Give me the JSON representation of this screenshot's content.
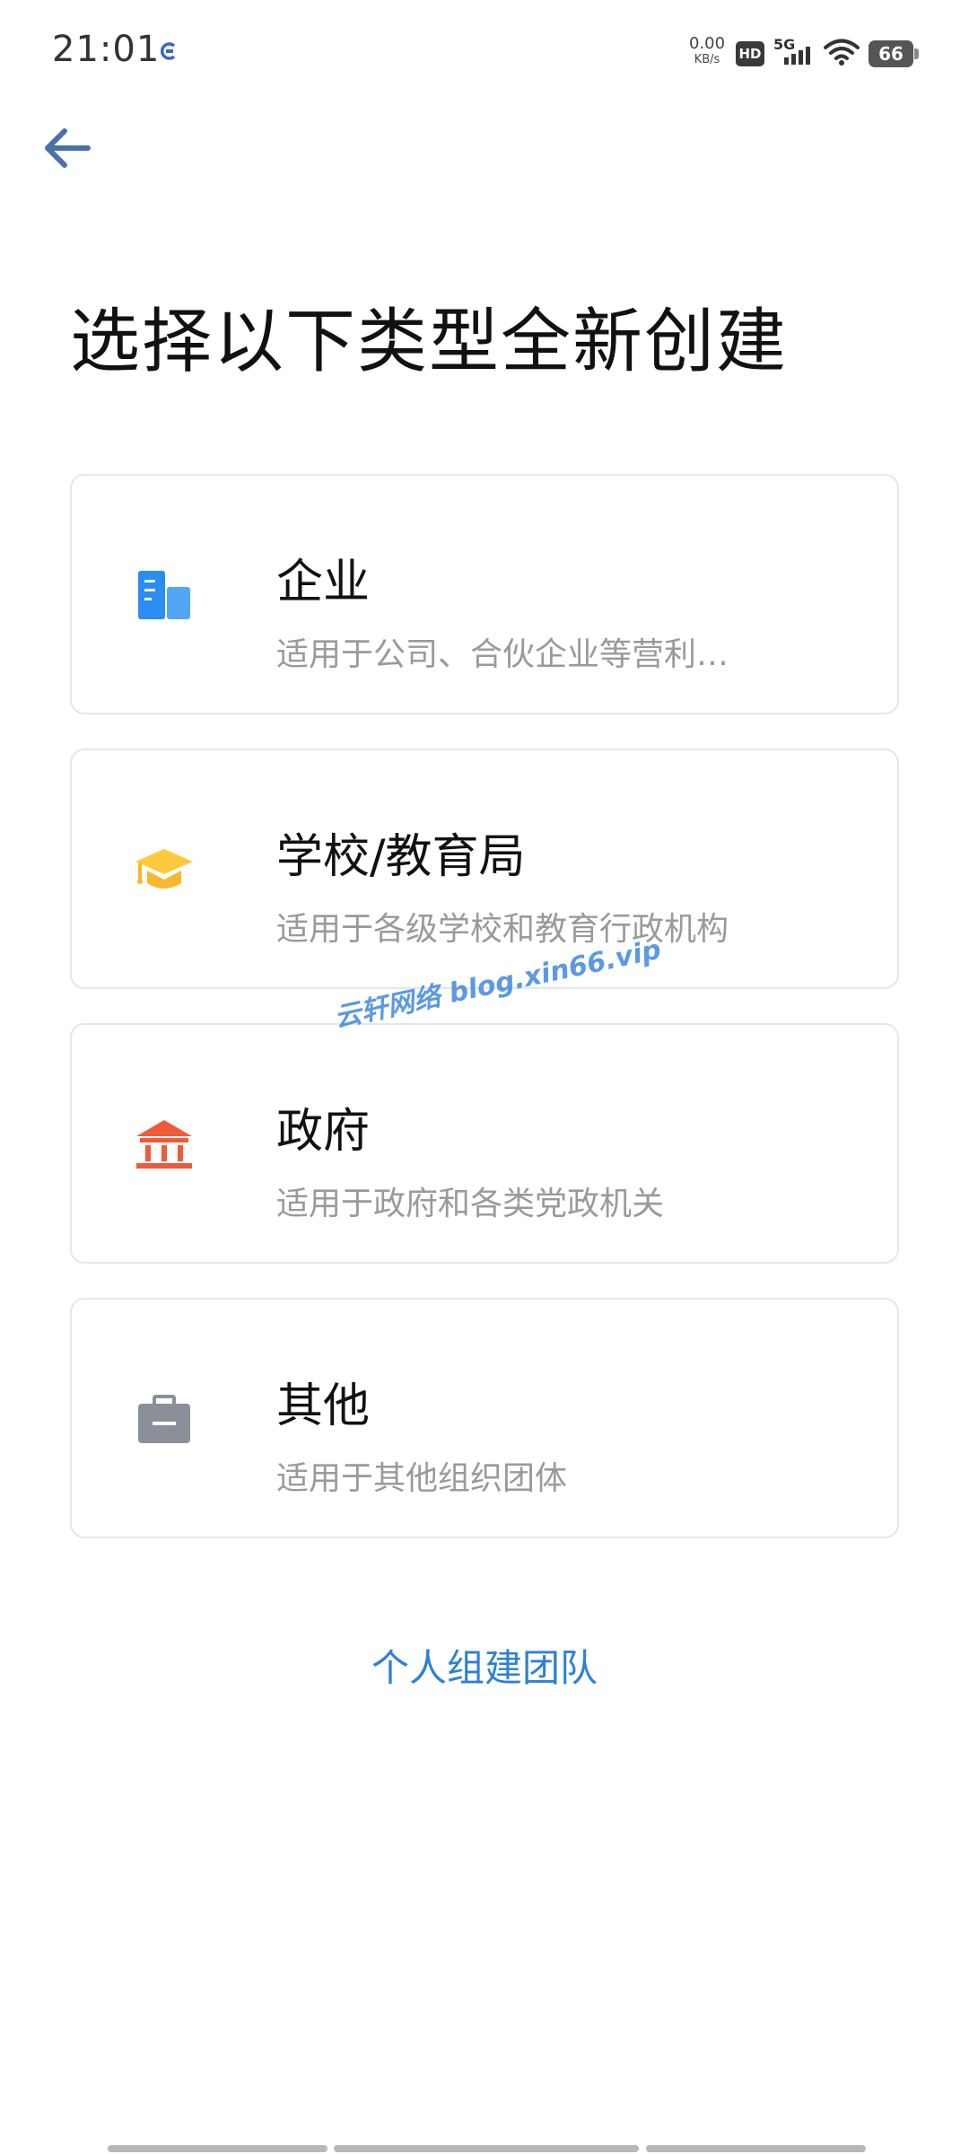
{
  "status_bar": {
    "time": "21:01",
    "net_speed_value": "0.00",
    "net_speed_unit": "KB/s",
    "hd_label": "HD",
    "network_type": "5G",
    "battery_level": "66",
    "app_icon": "browser-indicator-icon"
  },
  "nav": {
    "back_icon": "arrow-left-icon"
  },
  "page": {
    "title": "选择以下类型全新创建"
  },
  "cards": [
    {
      "title": "企业",
      "desc": "适用于公司、合伙企业等营利…",
      "icon": "building-icon",
      "icon_color": "#2B8CF2"
    },
    {
      "title": "学校/教育局",
      "desc": "适用于各级学校和教育行政机构",
      "icon": "graduation-cap-icon",
      "icon_color": "#F5B82E"
    },
    {
      "title": "政府",
      "desc": "适用于政府和各类党政机关",
      "icon": "government-building-icon",
      "icon_color": "#EF5B3A"
    },
    {
      "title": "其他",
      "desc": "适用于其他组织团体",
      "icon": "briefcase-icon",
      "icon_color": "#8A9099"
    }
  ],
  "personal_link": "个人组建团队",
  "watermark": "云轩网络 blog.xin66.vip",
  "colors": {
    "link": "#2F80D6",
    "back_arrow": "#4A72A8",
    "card_border": "#E4E6EA"
  }
}
